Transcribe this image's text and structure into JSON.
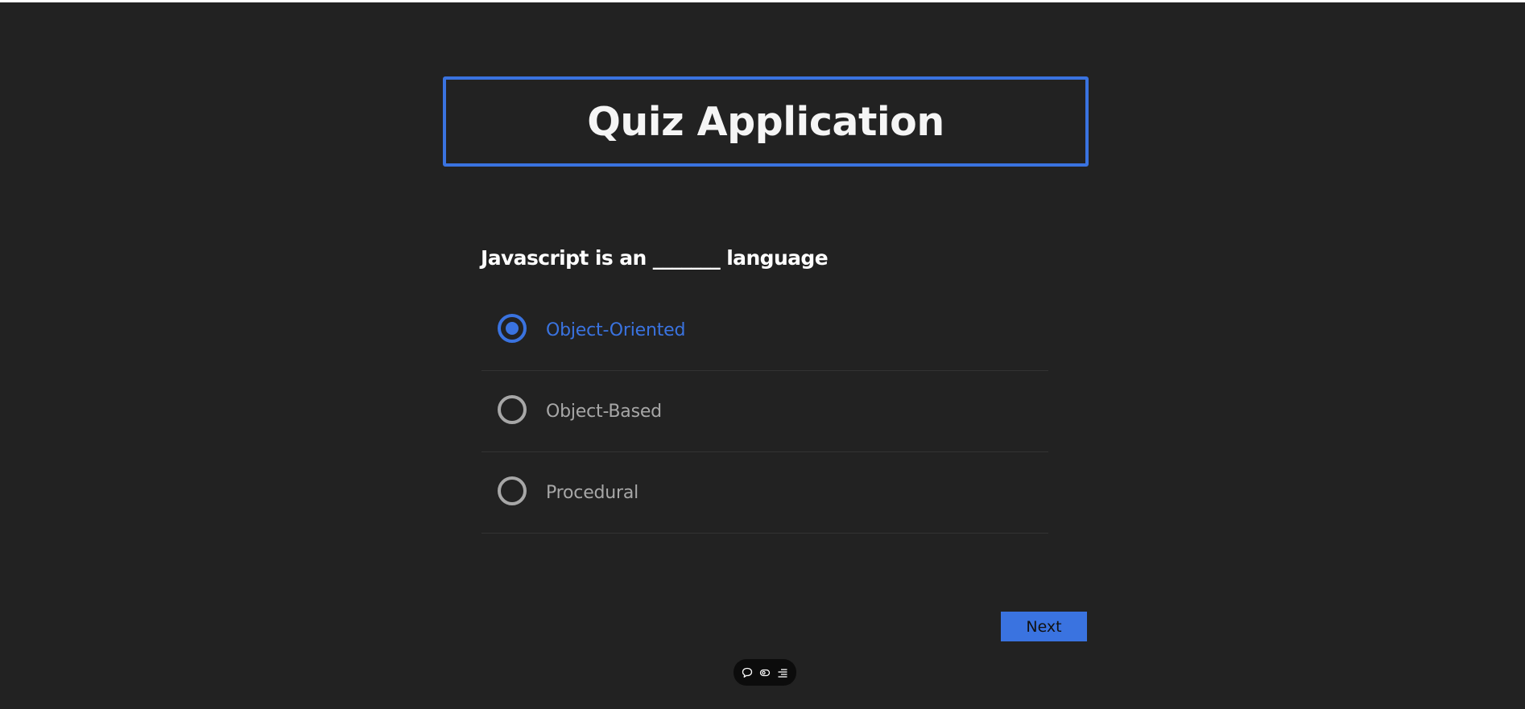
{
  "app": {
    "title": "Quiz Application"
  },
  "quiz": {
    "question": "Javascript is an _______ language",
    "options": [
      {
        "label": "Object-Oriented",
        "selected": true
      },
      {
        "label": "Object-Based",
        "selected": false
      },
      {
        "label": "Procedural",
        "selected": false
      }
    ],
    "next_label": "Next"
  },
  "toolbar": {
    "icons": [
      "comment-icon",
      "eye-icon",
      "menu-icon"
    ]
  },
  "colors": {
    "background": "#222222",
    "accent": "#3a73e0",
    "option_text": "#a7a7a7"
  }
}
